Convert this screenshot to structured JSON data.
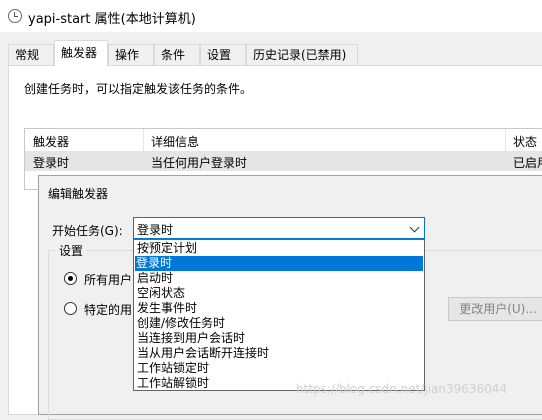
{
  "window": {
    "title": "yapi-start 属性(本地计算机)"
  },
  "tabs": [
    {
      "label": "常规"
    },
    {
      "label": "触发器"
    },
    {
      "label": "操作"
    },
    {
      "label": "条件"
    },
    {
      "label": "设置"
    },
    {
      "label": "历史记录(已禁用)"
    }
  ],
  "intro_text": "创建任务时，可以指定触发该任务的条件。",
  "triggers_table": {
    "columns": [
      "触发器",
      "详细信息",
      "状态"
    ],
    "rows": [
      {
        "trigger": "登录时",
        "detail": "当任何用户登录时",
        "status": "已启用"
      }
    ]
  },
  "edit_dialog": {
    "title": "编辑触发器",
    "start_label": "开始任务(G):",
    "start_value": "登录时",
    "settings_label": "设置",
    "radio_all_users": "所有用户",
    "radio_specific_user": "特定的用",
    "change_user_button": "更改用户(U)...",
    "dropdown_items": [
      "按预定计划",
      "登录时",
      "启动时",
      "空闲状态",
      "发生事件时",
      "创建/修改任务时",
      "当连接到用户会话时",
      "当从用户会话断开连接时",
      "工作站锁定时",
      "工作站解锁时"
    ]
  },
  "watermark": "https://blog.csdn.net/jian39636044"
}
